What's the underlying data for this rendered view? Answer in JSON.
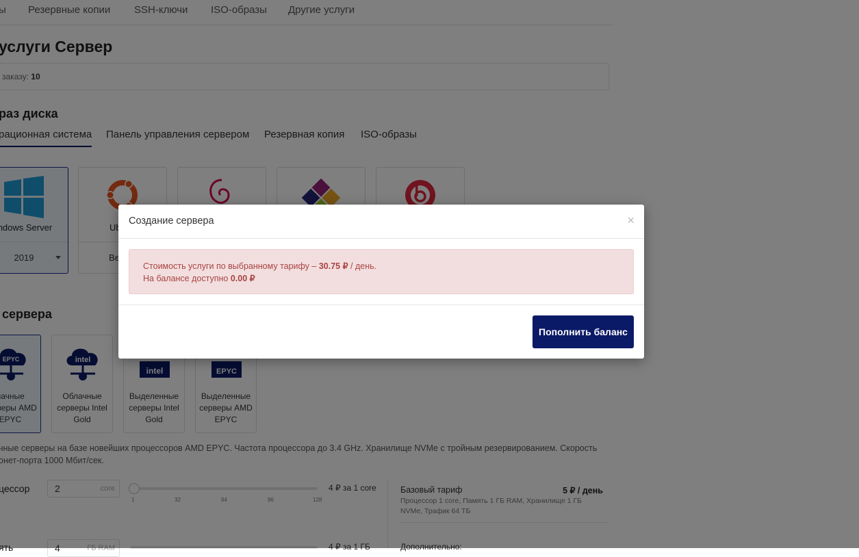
{
  "top_tabs": [
    "ы",
    "Резервные копии",
    "SSH-ключи",
    "ISO-образы",
    "Другие услуги"
  ],
  "page_title": "услуги Сервер",
  "order": {
    "label": "заказу:",
    "number": "10"
  },
  "disk_section_title": "раз диска",
  "image_tabs": [
    "рационная система",
    "Панель управления сервером",
    "Резервная копия",
    "ISO-образы"
  ],
  "os_cards": [
    {
      "name": "indows Server",
      "version": "2019",
      "selected": true,
      "icon": "windows-logo"
    },
    {
      "name": "Ub",
      "version": "Ве",
      "selected": false,
      "icon": "ubuntu-logo"
    },
    {
      "name": "",
      "version": "",
      "selected": false,
      "icon": "debian-logo"
    },
    {
      "name": "",
      "version": "",
      "selected": false,
      "icon": "centos-logo"
    },
    {
      "name": "",
      "version": "",
      "selected": false,
      "icon": "bitrix-logo"
    }
  ],
  "server_section_title": "сервера",
  "cpu_cards": [
    {
      "label": "лачные серверы AMD EPYC",
      "icon": "amd-epyc-cloud-icon",
      "selected": true
    },
    {
      "label": "Облачные серверы Intel Gold",
      "icon": "intel-cloud-icon",
      "selected": false
    },
    {
      "label": "Выделенные серверы Intel Gold",
      "icon": "intel-chip-icon",
      "selected": false
    },
    {
      "label": "Выделенные серверы AMD EPYC",
      "icon": "amd-epyc-chip-icon",
      "selected": false
    }
  ],
  "description": {
    "line1": "чные серверы на базе новейших процессоров AMD EPYC. Частота процессора до 3.4 GHz. Хранилище NVMe с тройным резервированием. Скорость",
    "line2": "онет-порта 1000 Мбит/сек."
  },
  "params": {
    "cpu": {
      "label": "цессор",
      "value": "2",
      "unit": "core",
      "price": "4 ₽ за 1 core",
      "ticks": [
        "1",
        "32",
        "64",
        "96",
        "128"
      ]
    },
    "ram": {
      "label": "ять",
      "value": "4",
      "unit": "ГБ RAM",
      "price": "4 ₽ за 1 ГБ"
    }
  },
  "summary": {
    "base_label": "Базовый тариф",
    "base_price": "5 ₽ / день",
    "base_desc": "Процессор 1 core, Память 1 ГБ RAM, Хранилище 1 ГБ NVMe, Трафик 64 ТБ",
    "extra_label": "Дополнительно:"
  },
  "modal": {
    "title": "Создание сервера",
    "close": "×",
    "cost_text": "Стоимость услуги по выбранному тарифу –",
    "cost_value": "30.75 ₽",
    "cost_suffix": "/ день.",
    "balance_text": "На балансе доступно",
    "balance_value": "0.00 ₽",
    "button": "Пополнить баланс"
  },
  "colors": {
    "accent": "#0b1a66",
    "alert_bg": "#f2dede",
    "alert_text": "#a94442"
  }
}
